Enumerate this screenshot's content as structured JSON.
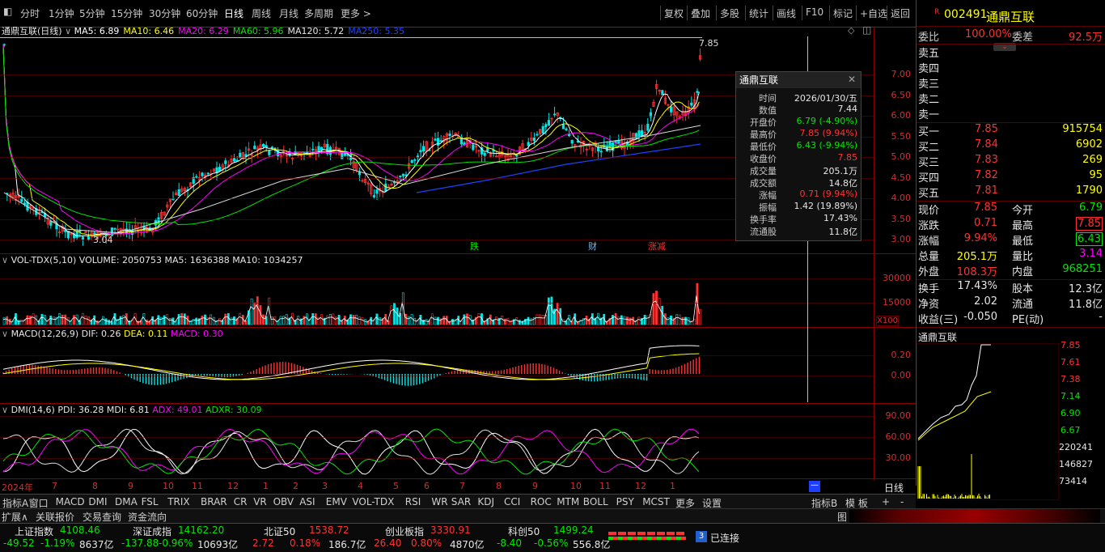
{
  "toolbar": {
    "periods": [
      "分时",
      "1分钟",
      "5分钟",
      "15分钟",
      "30分钟",
      "60分钟",
      "日线",
      "周线",
      "月线",
      "多周期",
      "更多 >"
    ],
    "active_period": "日线",
    "tools": [
      "复权",
      "叠加",
      "多股",
      "统计",
      "画线",
      "F10",
      "标记",
      "+自选",
      "返回"
    ]
  },
  "main_chart": {
    "name": "通鼎互联(日线)",
    "ma": [
      {
        "label": "MA5: 6.89",
        "color": "#ffffff"
      },
      {
        "label": "MA10: 6.46",
        "color": "#ffff00"
      },
      {
        "label": "MA20: 6.29",
        "color": "#ff00ff"
      },
      {
        "label": "MA60: 5.96",
        "color": "#00e600"
      },
      {
        "label": "MA120: 5.72",
        "color": "#e6e6e6"
      },
      {
        "label": "MA250: 5.35",
        "color": "#2040ff"
      }
    ],
    "y_ticks": [
      "7.00",
      "6.50",
      "6.00",
      "5.50",
      "5.00",
      "4.50",
      "4.00",
      "3.50",
      "3.00"
    ],
    "high_mark": "7.85",
    "low_mark": "3.04",
    "events": [
      {
        "label": "跌",
        "color": "#00e600"
      },
      {
        "label": "财",
        "color": "#60c0ff"
      },
      {
        "label": "涨减",
        "color": "#ff3232"
      }
    ]
  },
  "tooltip": {
    "title": "通鼎互联",
    "rows": [
      {
        "k": "时间",
        "v": "2026/01/30/五",
        "c": "#e6e6e6"
      },
      {
        "k": "数值",
        "v": "7.44",
        "c": "#e6e6e6"
      },
      {
        "k": "开盘价",
        "v": "6.79 (-4.90%)",
        "c": "#00e600"
      },
      {
        "k": "最高价",
        "v": "7.85 (9.94%)",
        "c": "#ff3232"
      },
      {
        "k": "最低价",
        "v": "6.43 (-9.94%)",
        "c": "#00e600"
      },
      {
        "k": "收盘价",
        "v": "7.85",
        "c": "#ff3232"
      },
      {
        "k": "成交量",
        "v": "205.1万",
        "c": "#e6e6e6"
      },
      {
        "k": "成交额",
        "v": "14.8亿",
        "c": "#e6e6e6"
      },
      {
        "k": "涨幅",
        "v": "0.71 (9.94%)",
        "c": "#ff3232"
      },
      {
        "k": "振幅",
        "v": "1.42 (19.89%)",
        "c": "#e6e6e6"
      },
      {
        "k": "换手率",
        "v": "17.43%",
        "c": "#e6e6e6"
      },
      {
        "k": "流通股",
        "v": "11.8亿",
        "c": "#e6e6e6"
      }
    ]
  },
  "vol_panel": {
    "title": "VOL-TDX(5,10)",
    "volume": "VOLUME: 2050753",
    "ma5": "MA5: 1636388",
    "ma10": "MA10: 1034257",
    "y_ticks": [
      "30000",
      "15000"
    ],
    "unit": "X100"
  },
  "macd_panel": {
    "title": "MACD(12,26,9)",
    "dif": "DIF: 0.26",
    "dea": "DEA: 0.11",
    "macd": "MACD: 0.30",
    "y_ticks": [
      "0.20",
      "0.00"
    ]
  },
  "dmi_panel": {
    "title": "DMI(14,6)",
    "pdi": "PDI: 36.28",
    "mdi": "MDI: 6.81",
    "adx": "ADX: 49.01",
    "adxr": "ADXR: 30.09",
    "y_ticks": [
      "90.00",
      "60.00",
      "30.00"
    ]
  },
  "time_axis": {
    "labels": [
      "2024年",
      "7",
      "8",
      "9",
      "10",
      "11",
      "12",
      "1",
      "2",
      "3",
      "4",
      "5",
      "6",
      "7",
      "8",
      "9",
      "10",
      "11",
      "12",
      "1"
    ],
    "period_label": "日线"
  },
  "indicator_tabs": [
    "指标A",
    "窗口",
    "MACD",
    "DMI",
    "DMA",
    "FSL",
    "TRIX",
    "BRAR",
    "CR",
    "VR",
    "OBV",
    "ASI",
    "EMV",
    "VOL-TDX",
    "RSI",
    "WR",
    "SAR",
    "KDJ",
    "CCI",
    "ROC",
    "MTM",
    "BOLL",
    "PSY",
    "MCST",
    "更多",
    "设置"
  ],
  "right_tabs": [
    "指标B",
    "模 板",
    "+",
    "-"
  ],
  "bottom_tabs": [
    "扩展∧",
    "关联报价",
    "交易查询",
    "资金流向"
  ],
  "bottom_right_tab": "图",
  "quote": {
    "code": "002491",
    "name": "通鼎互联",
    "weibi_label": "委比",
    "weibi": "100.00%",
    "weicha_label": "委差",
    "weicha": "92.5万",
    "asks": [
      "卖五",
      "卖四",
      "卖三",
      "卖二",
      "卖一"
    ],
    "bids": [
      {
        "label": "买一",
        "price": "7.85",
        "vol": "915754"
      },
      {
        "label": "买二",
        "price": "7.84",
        "vol": "6902"
      },
      {
        "label": "买三",
        "price": "7.83",
        "vol": "269"
      },
      {
        "label": "买四",
        "price": "7.82",
        "vol": "95"
      },
      {
        "label": "买五",
        "price": "7.81",
        "vol": "1790"
      }
    ],
    "stats": [
      {
        "l1": "现价",
        "v1": "7.85",
        "c1": "#ff3232",
        "l2": "今开",
        "v2": "6.79",
        "c2": "#00e600"
      },
      {
        "l1": "涨跌",
        "v1": "0.71",
        "c1": "#ff3232",
        "l2": "最高",
        "v2": "7.85",
        "c2": "#ff3232"
      },
      {
        "l1": "涨幅",
        "v1": "9.94%",
        "c1": "#ff3232",
        "l2": "最低",
        "v2": "6.43",
        "c2": "#00e600"
      },
      {
        "l1": "总量",
        "v1": "205.1万",
        "c1": "#ffff00",
        "l2": "量比",
        "v2": "3.14",
        "c2": "#ff00ff"
      },
      {
        "l1": "外盘",
        "v1": "108.3万",
        "c1": "#ff3232",
        "l2": "内盘",
        "v2": "968251",
        "c2": "#00e600"
      }
    ],
    "stats2": [
      {
        "l1": "换手",
        "v1": "17.43%",
        "l2": "股本",
        "v2": "12.3亿"
      },
      {
        "l1": "净资",
        "v1": "2.02",
        "l2": "流通",
        "v2": "11.8亿"
      },
      {
        "l1": "收益(三)",
        "v1": "-0.050",
        "l2": "PE(动)",
        "v2": "-"
      }
    ],
    "mini_title": "通鼎互联",
    "mini_ticks": [
      "7.85",
      "7.61",
      "7.38",
      "7.14",
      "6.90",
      "6.67"
    ],
    "mini_vol_ticks": [
      "220241",
      "146827",
      "73414"
    ]
  },
  "status": [
    {
      "name": "上证指数",
      "value": "4108.46",
      "chg": "-49.52",
      "pct": "-1.19%",
      "amt": "8637亿",
      "vc": "#00e600"
    },
    {
      "name": "深证成指",
      "value": "14162.20",
      "chg": "-137.88",
      "pct": "-0.96%",
      "amt": "10693亿",
      "vc": "#00e600"
    },
    {
      "name": "北证50",
      "value": "1538.72",
      "chg": "2.72",
      "pct": "0.18%",
      "amt": "186.7亿",
      "vc": "#ff3232"
    },
    {
      "name": "创业板指",
      "value": "3330.91",
      "chg": "26.40",
      "pct": "0.80%",
      "amt": "4870亿",
      "vc": "#ff3232"
    },
    {
      "name": "科创50",
      "value": "1499.24",
      "chg": "-8.40",
      "pct": "-0.56%",
      "amt": "556.8亿",
      "vc": "#00e600"
    }
  ],
  "connection": {
    "count": "3",
    "text": "已连接"
  }
}
